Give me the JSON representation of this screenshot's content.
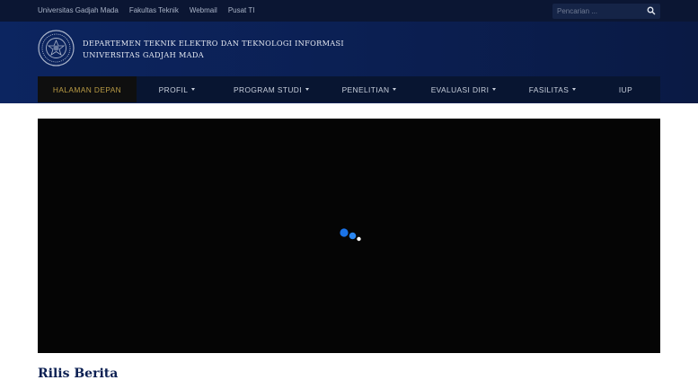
{
  "topbar": {
    "links": [
      "Universitas Gadjah Mada",
      "Fakultas Teknik",
      "Webmail",
      "Pusat TI"
    ],
    "search_placeholder": "Pencarian ..."
  },
  "header": {
    "dept_line1": "DEPARTEMEN TEKNIK ELEKTRO DAN TEKNOLOGI INFORMASI",
    "dept_line2": "UNIVERSITAS GADJAH MADA"
  },
  "nav": {
    "items": [
      {
        "label": "HALAMAN DEPAN"
      },
      {
        "label": "PROFIL"
      },
      {
        "label": "PROGRAM STUDI"
      },
      {
        "label": "PENELITIAN"
      },
      {
        "label": "EVALUASI DIRI"
      },
      {
        "label": "FASILITAS"
      },
      {
        "label": "IUP"
      }
    ]
  },
  "main": {
    "section_title": "Rilis Berita"
  },
  "colors": {
    "topbar_bg": "#0b1633",
    "header_bg": "#0c2560",
    "nav_bg": "#081531",
    "active_text": "#b99b45",
    "loader_blue": "#1a73e8"
  }
}
